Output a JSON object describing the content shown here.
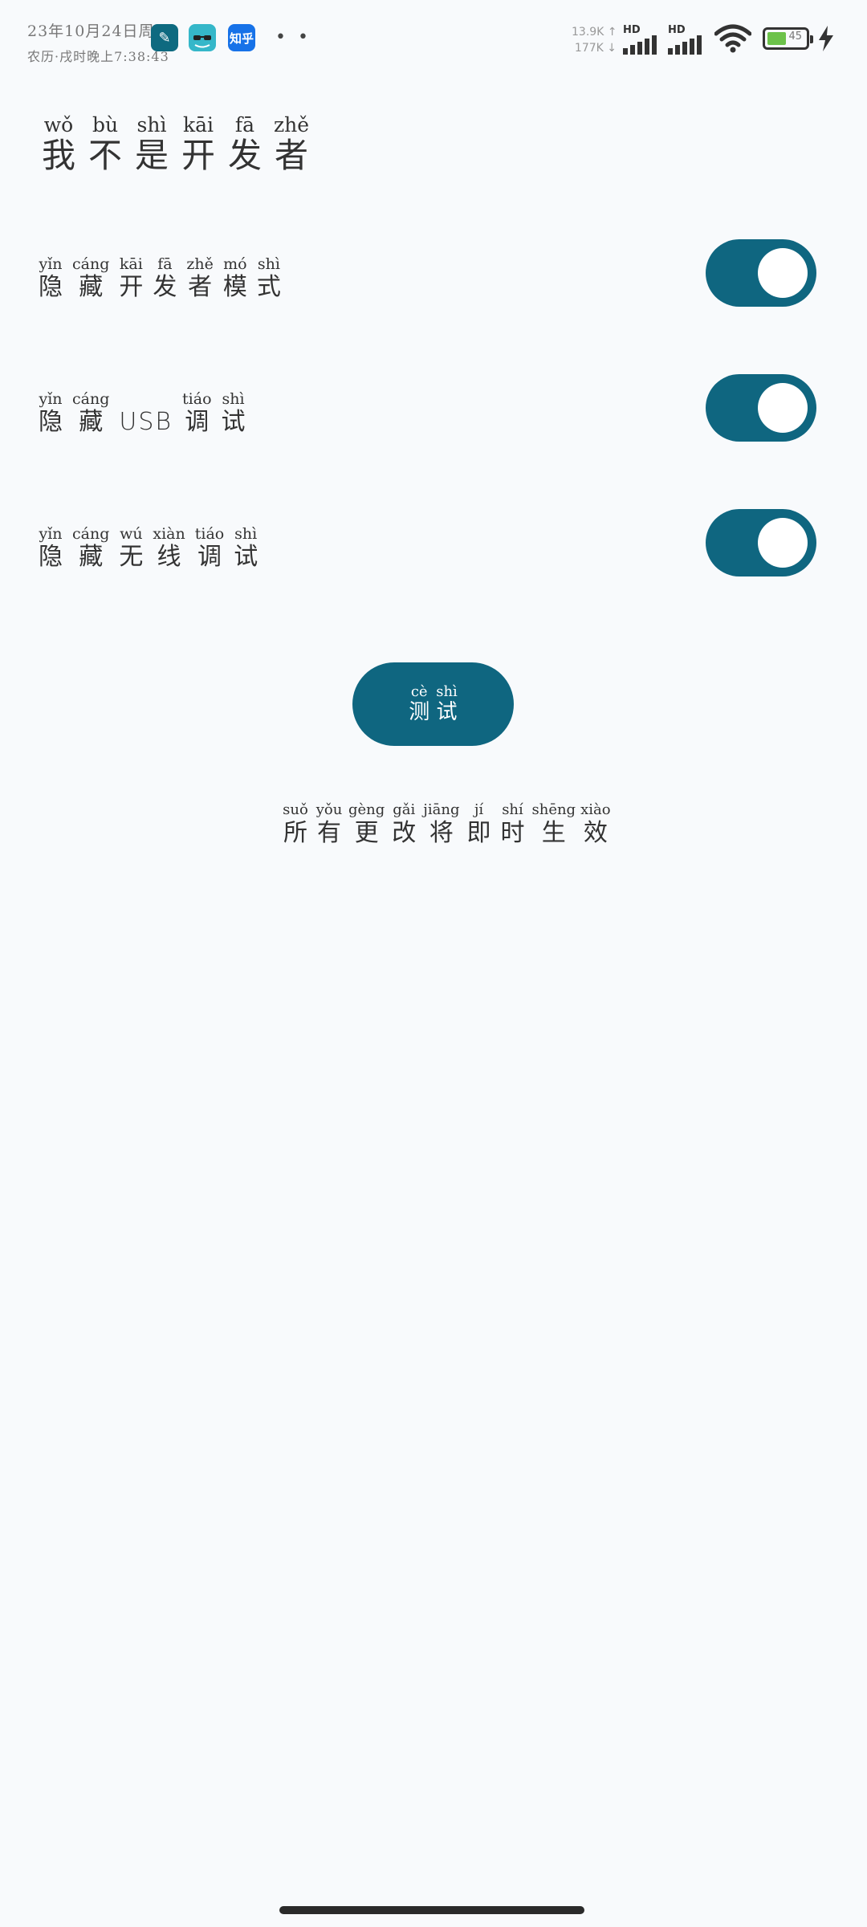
{
  "status_bar": {
    "time_line1": "23年10月24日周二",
    "time_line2": "农历·戌时晚上7:38:43",
    "apps": [
      {
        "icon": "clipboard-app-icon"
      },
      {
        "icon": "sunglasses-app-icon"
      },
      {
        "icon": "zhihu-app-icon",
        "label": "知乎"
      }
    ],
    "more": "• •",
    "speed_up": "13.9K ↑",
    "speed_down": "177K ↓",
    "sim1_label": "HD",
    "sim2_label": "HD",
    "battery_level": 0.45,
    "battery_text": "45",
    "charging": true
  },
  "heading": [
    {
      "py": "wǒ",
      "hz": "我"
    },
    {
      "py": "bù",
      "hz": "不"
    },
    {
      "py": "shì",
      "hz": "是"
    },
    {
      "py": "kāi",
      "hz": "开"
    },
    {
      "py": "fā",
      "hz": "发"
    },
    {
      "py": "zhě",
      "hz": "者"
    }
  ],
  "settings": [
    {
      "id": "hide-developer-mode",
      "chars": [
        {
          "py": "yǐn",
          "hz": "隐"
        },
        {
          "py": "cáng",
          "hz": "藏"
        },
        {
          "py": "kāi",
          "hz": "开"
        },
        {
          "py": "fā",
          "hz": "发"
        },
        {
          "py": "zhě",
          "hz": "者"
        },
        {
          "py": "mó",
          "hz": "模"
        },
        {
          "py": "shì",
          "hz": "式"
        }
      ],
      "enabled": true
    },
    {
      "id": "hide-usb-debugging",
      "chars": [
        {
          "py": "yǐn",
          "hz": "隐"
        },
        {
          "py": "cáng",
          "hz": "藏"
        },
        {
          "py": "",
          "hz": "USB"
        },
        {
          "py": "tiáo",
          "hz": "调"
        },
        {
          "py": "shì",
          "hz": "试"
        }
      ],
      "enabled": true
    },
    {
      "id": "hide-wireless-debugging",
      "chars": [
        {
          "py": "yǐn",
          "hz": "隐"
        },
        {
          "py": "cáng",
          "hz": "藏"
        },
        {
          "py": "wú",
          "hz": "无"
        },
        {
          "py": "xiàn",
          "hz": "线"
        },
        {
          "py": "tiáo",
          "hz": "调"
        },
        {
          "py": "shì",
          "hz": "试"
        }
      ],
      "enabled": true
    }
  ],
  "test_button": [
    {
      "py": "cè",
      "hz": "测"
    },
    {
      "py": "shì",
      "hz": "试"
    }
  ],
  "note": [
    {
      "py": "suǒ",
      "hz": "所"
    },
    {
      "py": "yǒu",
      "hz": "有"
    },
    {
      "py": "gèng",
      "hz": "更"
    },
    {
      "py": "gǎi",
      "hz": "改"
    },
    {
      "py": "jiāng",
      "hz": "将"
    },
    {
      "py": "jí",
      "hz": "即"
    },
    {
      "py": "shí",
      "hz": "时"
    },
    {
      "py": "shēng",
      "hz": "生"
    },
    {
      "py": "xiào",
      "hz": "效"
    }
  ],
  "colors": {
    "accent": "#0f6680",
    "background": "#f8fafc",
    "text": "#333333"
  }
}
